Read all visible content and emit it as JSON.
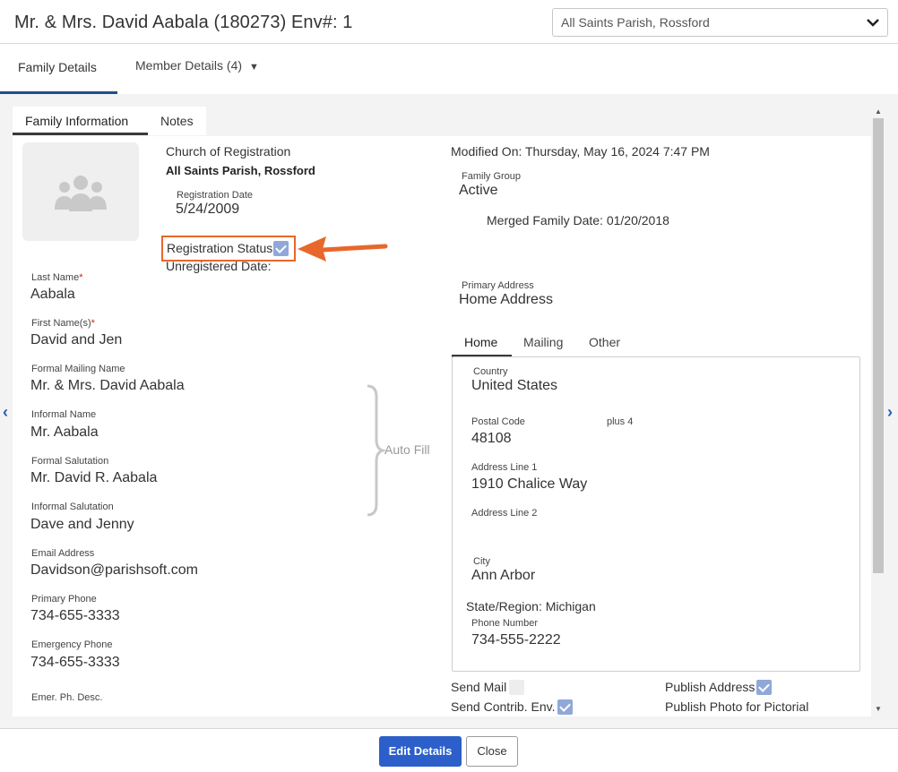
{
  "header": {
    "title": "Mr. & Mrs. David Aabala (180273) Env#: 1",
    "parish_select": "All Saints Parish, Rossford"
  },
  "nav_tabs": [
    {
      "label": "Family Details"
    },
    {
      "label": "Member Details (4)"
    }
  ],
  "inner_tabs": [
    {
      "label": "Family Information"
    },
    {
      "label": "Notes"
    }
  ],
  "church": {
    "label": "Church of Registration",
    "value": "All Saints Parish, Rossford"
  },
  "registration_date": {
    "label": "Registration Date",
    "value": "5/24/2009"
  },
  "registration_status": {
    "label": "Registration Status",
    "checked": true
  },
  "unregistered_date": {
    "label": "Unregistered Date:"
  },
  "modified_on": "Modified On: Thursday, May 16, 2024 7:47 PM",
  "family_group": {
    "label": "Family Group",
    "value": "Active"
  },
  "merged_family_date": "Merged Family Date: 01/20/2018",
  "primary_address": {
    "label": "Primary Address",
    "value": "Home Address"
  },
  "fields": {
    "last_name": {
      "label": "Last Name",
      "value": "Aabala"
    },
    "first_names": {
      "label": "First Name(s)",
      "value": "David and Jen"
    },
    "formal_mailing_name": {
      "label": "Formal Mailing Name",
      "value": "Mr. & Mrs. David Aabala"
    },
    "informal_name": {
      "label": "Informal Name",
      "value": "Mr. Aabala"
    },
    "formal_salutation": {
      "label": "Formal Salutation",
      "value": "Mr. David R. Aabala"
    },
    "informal_salutation": {
      "label": "Informal Salutation",
      "value": "Dave and Jenny"
    },
    "email": {
      "label": "Email Address",
      "value": "Davidson@parishsoft.com"
    },
    "primary_phone": {
      "label": "Primary Phone",
      "value": "734-655-3333"
    },
    "emergency_phone": {
      "label": "Emergency Phone",
      "value": "734-655-3333"
    },
    "emer_ph_desc": {
      "label": "Emer. Ph. Desc."
    }
  },
  "auto_fill": "Auto Fill",
  "address_tabs": [
    {
      "label": "Home"
    },
    {
      "label": "Mailing"
    },
    {
      "label": "Other"
    }
  ],
  "address": {
    "country": {
      "label": "Country",
      "value": "United States"
    },
    "postal_code": {
      "label": "Postal Code",
      "value": "48108"
    },
    "plus4": {
      "label": "plus 4"
    },
    "line1": {
      "label": "Address Line 1",
      "value": "1910 Chalice Way"
    },
    "line2": {
      "label": "Address Line 2",
      "value": ""
    },
    "city": {
      "label": "City",
      "value": "Ann Arbor"
    },
    "state": "State/Region: Michigan",
    "phone": {
      "label": "Phone Number",
      "value": "734-555-2222"
    }
  },
  "options": {
    "send_mail": {
      "label": "Send Mail",
      "checked": false
    },
    "publish_address": {
      "label": "Publish Address",
      "checked": true
    },
    "send_contrib": {
      "label": "Send Contrib. Env.",
      "checked": true
    },
    "publish_photo": {
      "label": "Publish Photo for Pictorial",
      "checked": false
    }
  },
  "footer": {
    "edit_label": "Edit Details",
    "close_label": "Close"
  },
  "colors": {
    "primary": "#2c5fc9",
    "tab_underline": "#1f4e8c",
    "highlight": "#e8672a",
    "checkbox": "#8fa8d8"
  }
}
